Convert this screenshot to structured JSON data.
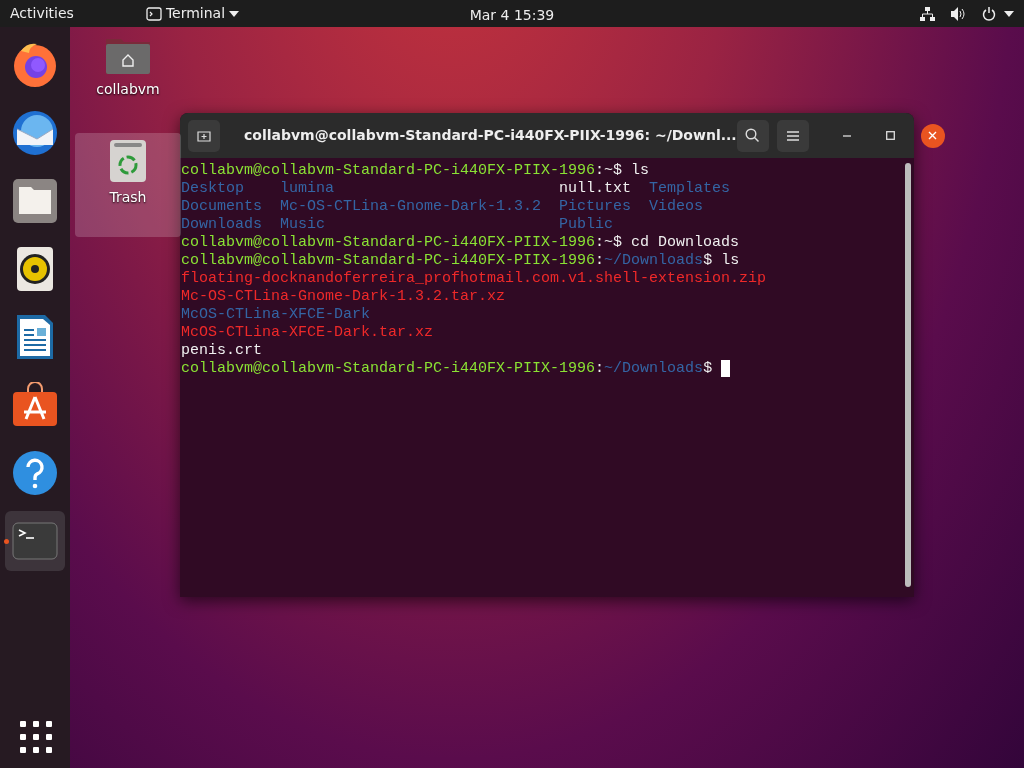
{
  "top_bar": {
    "activities": "Activities",
    "app_menu": "Terminal",
    "clock": "Mar 4  15:39"
  },
  "dock": {
    "items": [
      {
        "kind": "browser",
        "running": false,
        "selected": false
      },
      {
        "kind": "mail",
        "running": false,
        "selected": false
      },
      {
        "kind": "files",
        "running": false,
        "selected": false
      },
      {
        "kind": "music",
        "running": false,
        "selected": false
      },
      {
        "kind": "writer",
        "running": false,
        "selected": false
      },
      {
        "kind": "store",
        "running": false,
        "selected": false
      },
      {
        "kind": "help",
        "running": false,
        "selected": false
      },
      {
        "kind": "terminal",
        "running": true,
        "selected": true
      }
    ]
  },
  "desktop_icons": [
    {
      "kind": "home",
      "label": "collabvm",
      "selected": false
    },
    {
      "kind": "trash",
      "label": "Trash",
      "selected": true
    }
  ],
  "terminal": {
    "title": "collabvm@collabvm-Standard-PC-i440FX-PIIX-1996: ~/Downl...",
    "lines": [
      {
        "kind": "line",
        "segments": [
          {
            "kind": "prompt",
            "text": "collabvm@collabvm-Standard-PC-i440FX-PIIX-1996"
          },
          {
            "kind": "plain",
            "text": ":~$ ls"
          }
        ]
      },
      {
        "kind": "grid",
        "cells": [
          {
            "kind": "dir",
            "text": "Desktop"
          },
          {
            "kind": "dir",
            "text": "lumina"
          },
          {
            "kind": "plain",
            "text": "null.txt"
          },
          {
            "kind": "dir",
            "text": "Templates"
          }
        ]
      },
      {
        "kind": "grid",
        "cells": [
          {
            "kind": "dir",
            "text": "Documents"
          },
          {
            "kind": "dir",
            "text": "Mc-OS-CTLina-Gnome-Dark-1.3.2"
          },
          {
            "kind": "dir",
            "text": "Pictures"
          },
          {
            "kind": "dir",
            "text": "Videos"
          }
        ]
      },
      {
        "kind": "grid",
        "cells": [
          {
            "kind": "dir",
            "text": "Downloads"
          },
          {
            "kind": "dir",
            "text": "Music"
          },
          {
            "kind": "dir",
            "text": "Public"
          }
        ]
      },
      {
        "kind": "line",
        "segments": [
          {
            "kind": "prompt",
            "text": "collabvm@collabvm-Standard-PC-i440FX-PIIX-1996"
          },
          {
            "kind": "plain",
            "text": ":~$ cd Downloads"
          }
        ]
      },
      {
        "kind": "line",
        "segments": [
          {
            "kind": "prompt",
            "text": "collabvm@collabvm-Standard-PC-i440FX-PIIX-1996"
          },
          {
            "kind": "plain",
            "text": ":"
          },
          {
            "kind": "dir",
            "text": "~/Downloads"
          },
          {
            "kind": "plain",
            "text": "$ ls"
          }
        ]
      },
      {
        "kind": "line",
        "segments": [
          {
            "kind": "archive",
            "text": "floating-docknandoferreira_profhotmail.com.v1.shell-extension.zip"
          }
        ]
      },
      {
        "kind": "line",
        "segments": [
          {
            "kind": "archive",
            "text": "Mc-OS-CTLina-Gnome-Dark-1.3.2.tar.xz"
          }
        ]
      },
      {
        "kind": "line",
        "segments": [
          {
            "kind": "dir",
            "text": "McOS-CTLina-XFCE-Dark"
          }
        ]
      },
      {
        "kind": "line",
        "segments": [
          {
            "kind": "archive",
            "text": "McOS-CTLina-XFCE-Dark.tar.xz"
          }
        ]
      },
      {
        "kind": "line",
        "segments": [
          {
            "kind": "plain",
            "text": "penis.crt"
          }
        ]
      },
      {
        "kind": "line",
        "cursor": true,
        "segments": [
          {
            "kind": "prompt",
            "text": "collabvm@collabvm-Standard-PC-i440FX-PIIX-1996"
          },
          {
            "kind": "plain",
            "text": ":"
          },
          {
            "kind": "dir",
            "text": "~/Downloads"
          },
          {
            "kind": "plain",
            "text": "$ "
          }
        ]
      }
    ]
  }
}
